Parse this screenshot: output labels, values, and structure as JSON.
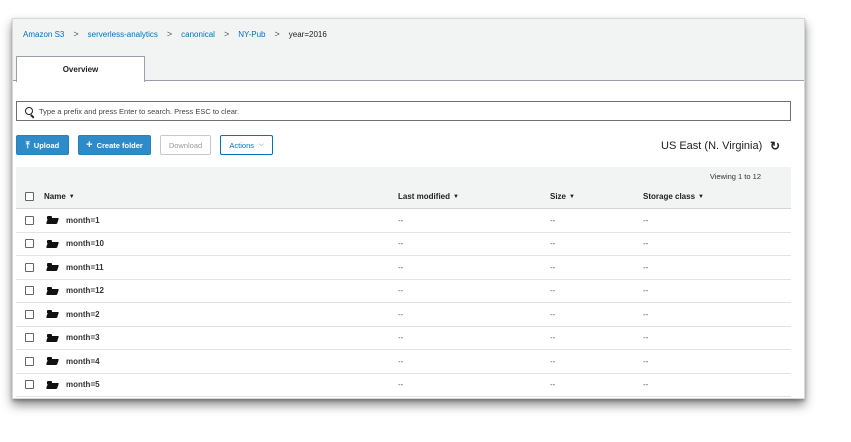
{
  "breadcrumb": [
    {
      "label": "Amazon S3",
      "link": true
    },
    {
      "label": "serverless-analytics",
      "link": true
    },
    {
      "label": "canonical",
      "link": true
    },
    {
      "label": "NY-Pub",
      "link": true
    },
    {
      "label": "year=2016",
      "link": false
    }
  ],
  "breadcrumb_separator": ">",
  "tabs": {
    "overview": "Overview"
  },
  "search": {
    "placeholder": "Type a prefix and press Enter to search. Press ESC to clear.",
    "value": ""
  },
  "toolbar": {
    "upload_label": "Upload",
    "create_folder_label": "Create folder",
    "download_label": "Download",
    "actions_label": "Actions"
  },
  "region": "US East (N. Virginia)",
  "viewing": "Viewing 1 to 12",
  "table": {
    "columns": {
      "name": "Name",
      "modified": "Last modified",
      "size": "Size",
      "storage": "Storage class"
    },
    "rows": [
      {
        "name": "month=1",
        "modified": "--",
        "size": "--",
        "storage": "--"
      },
      {
        "name": "month=10",
        "modified": "--",
        "size": "--",
        "storage": "--"
      },
      {
        "name": "month=11",
        "modified": "--",
        "size": "--",
        "storage": "--"
      },
      {
        "name": "month=12",
        "modified": "--",
        "size": "--",
        "storage": "--"
      },
      {
        "name": "month=2",
        "modified": "--",
        "size": "--",
        "storage": "--"
      },
      {
        "name": "month=3",
        "modified": "--",
        "size": "--",
        "storage": "--"
      },
      {
        "name": "month=4",
        "modified": "--",
        "size": "--",
        "storage": "--"
      },
      {
        "name": "month=5",
        "modified": "--",
        "size": "--",
        "storage": "--"
      }
    ]
  },
  "colors": {
    "link": "#0073bb",
    "primary_button": "#2e8bc9",
    "band": "#f2f3f3"
  },
  "icons": {
    "search": "search-icon",
    "upload": "upload-icon",
    "create_folder": "plus-icon",
    "refresh": "refresh-icon",
    "folder": "folder-icon",
    "sort": "caret-down-icon"
  }
}
